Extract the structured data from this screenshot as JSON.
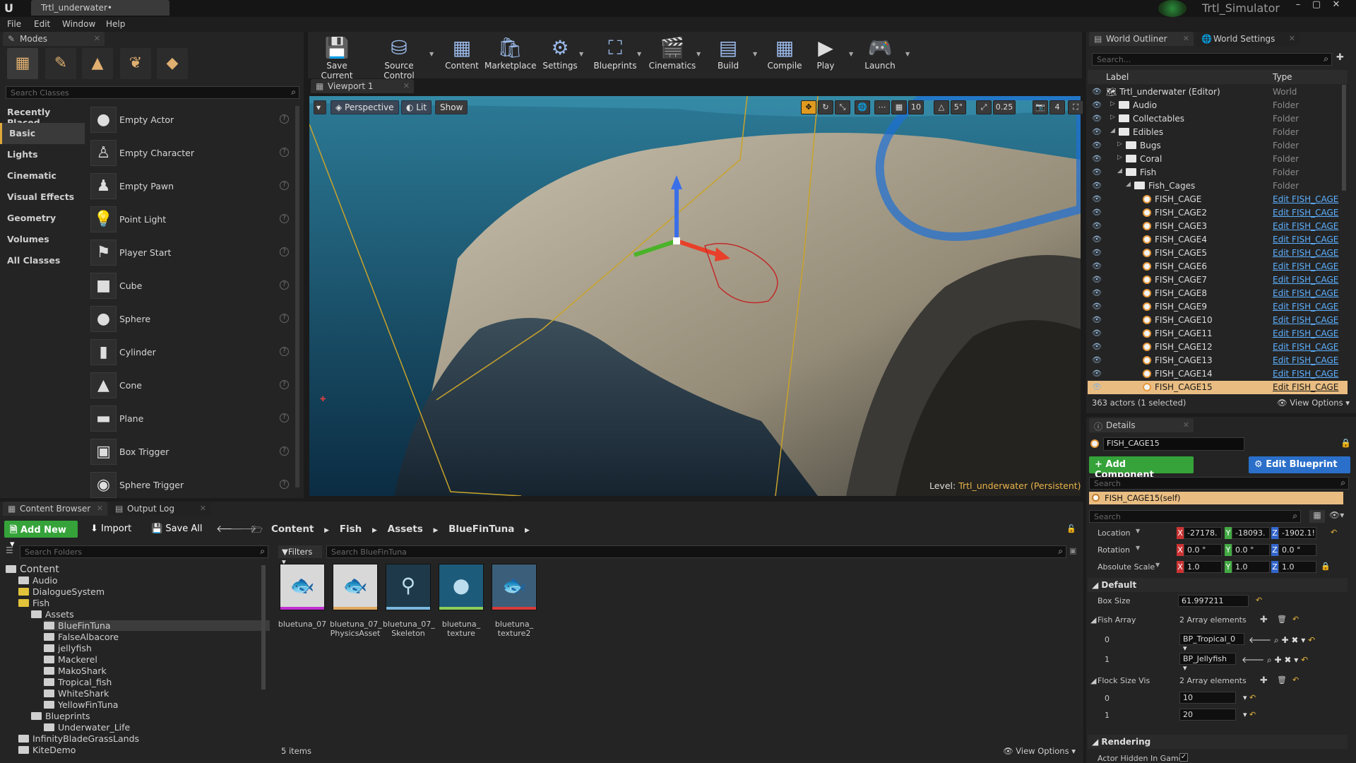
{
  "titlebar": {
    "doc_tab": "Trtl_underwater•",
    "app_title": "Trtl_Simulator",
    "min": "–",
    "max": "▢",
    "close": "✕"
  },
  "menu": [
    "File",
    "Edit",
    "Window",
    "Help"
  ],
  "modes": {
    "tab": "Modes",
    "search_placeholder": "Search Classes",
    "categories": [
      "Recently Placed",
      "Basic",
      "Lights",
      "Cinematic",
      "Visual Effects",
      "Geometry",
      "Volumes",
      "All Classes"
    ],
    "selected_category": "Basic",
    "items": [
      "Empty Actor",
      "Empty Character",
      "Empty Pawn",
      "Point Light",
      "Player Start",
      "Cube",
      "Sphere",
      "Cylinder",
      "Cone",
      "Plane",
      "Box Trigger",
      "Sphere Trigger"
    ],
    "help": "?"
  },
  "toolbar": [
    "Save Current",
    "Source Control",
    "Content",
    "Marketplace",
    "Settings",
    "Blueprints",
    "Cinematics",
    "Build",
    "Compile",
    "Play",
    "Launch"
  ],
  "viewport": {
    "tab": "Viewport 1",
    "perspective": "Perspective",
    "lit": "Lit",
    "show": "Show",
    "grid": "10",
    "angle": "5°",
    "scale": "0.25",
    "cam": "4",
    "level_label": "Level:",
    "level_name": "Trtl_underwater (Persistent)"
  },
  "outliner": {
    "tab": "World Outliner",
    "tab2": "World Settings",
    "search_placeholder": "Search...",
    "col_label": "Label",
    "col_type": "Type",
    "rows": [
      {
        "label": "Trtl_underwater (Editor)",
        "type": "World"
      },
      {
        "label": "Audio",
        "type": "Folder"
      },
      {
        "label": "Collectables",
        "type": "Folder"
      },
      {
        "label": "Edibles",
        "type": "Folder"
      },
      {
        "label": "Bugs",
        "type": "Folder"
      },
      {
        "label": "Coral",
        "type": "Folder"
      },
      {
        "label": "Fish",
        "type": "Folder"
      },
      {
        "label": "Fish_Cages",
        "type": "Folder"
      },
      {
        "label": "FISH_CAGE",
        "type": "Edit FISH_CAGE"
      },
      {
        "label": "FISH_CAGE2",
        "type": "Edit FISH_CAGE"
      },
      {
        "label": "FISH_CAGE3",
        "type": "Edit FISH_CAGE"
      },
      {
        "label": "FISH_CAGE4",
        "type": "Edit FISH_CAGE"
      },
      {
        "label": "FISH_CAGE5",
        "type": "Edit FISH_CAGE"
      },
      {
        "label": "FISH_CAGE6",
        "type": "Edit FISH_CAGE"
      },
      {
        "label": "FISH_CAGE7",
        "type": "Edit FISH_CAGE"
      },
      {
        "label": "FISH_CAGE8",
        "type": "Edit FISH_CAGE"
      },
      {
        "label": "FISH_CAGE9",
        "type": "Edit FISH_CAGE"
      },
      {
        "label": "FISH_CAGE10",
        "type": "Edit FISH_CAGE"
      },
      {
        "label": "FISH_CAGE11",
        "type": "Edit FISH_CAGE"
      },
      {
        "label": "FISH_CAGE12",
        "type": "Edit FISH_CAGE"
      },
      {
        "label": "FISH_CAGE13",
        "type": "Edit FISH_CAGE"
      },
      {
        "label": "FISH_CAGE14",
        "type": "Edit FISH_CAGE"
      },
      {
        "label": "FISH_CAGE15",
        "type": "Edit FISH_CAGE"
      }
    ],
    "status": "363 actors (1 selected)",
    "view_options": "View Options"
  },
  "details": {
    "tab": "Details",
    "name": "FISH_CAGE15",
    "add_component": "+ Add Component",
    "edit_blueprint": "Edit Blueprint",
    "search_placeholder": "Search",
    "self_row": "FISH_CAGE15(self)",
    "search2_placeholder": "Search",
    "location_label": "Location",
    "location": [
      "-27178.",
      "-18093.",
      "-1902.1!"
    ],
    "rotation_label": "Rotation",
    "rotation": [
      "0.0 °",
      "0.0 °",
      "0.0 °"
    ],
    "scale_label": "Absolute Scale",
    "scale": [
      "1.0",
      "1.0",
      "1.0"
    ],
    "section_default": "Default",
    "box_size_label": "Box Size",
    "box_size": "61.997211",
    "fish_array_label": "Fish Array",
    "fish_array_count": "2 Array elements",
    "fish0": "BP_Tropical_0",
    "fish1": "BP_Jellyfish",
    "flock_label": "Flock Size Vis",
    "flock_count": "2 Array elements",
    "flock0": "10",
    "flock1": "20",
    "idx0": "0",
    "idx1": "1",
    "section_rendering": "Rendering",
    "hidden_label": "Actor Hidden In Game"
  },
  "content_browser": {
    "tab": "Content Browser",
    "tab2": "Output Log",
    "add_new": "Add New",
    "import": "Import",
    "save_all": "Save All",
    "path": [
      "Content",
      "Fish",
      "Assets",
      "BlueFinTuna"
    ],
    "search_folders": "Search Folders",
    "filters": "Filters",
    "search_assets": "Search BlueFinTuna",
    "tree": [
      {
        "label": "Content",
        "depth": 0
      },
      {
        "label": "Audio",
        "depth": 1
      },
      {
        "label": "DialogueSystem",
        "depth": 1
      },
      {
        "label": "Fish",
        "depth": 1
      },
      {
        "label": "Assets",
        "depth": 2
      },
      {
        "label": "BlueFinTuna",
        "depth": 3
      },
      {
        "label": "FalseAlbacore",
        "depth": 3
      },
      {
        "label": "jellyfish",
        "depth": 3
      },
      {
        "label": "Mackerel",
        "depth": 3
      },
      {
        "label": "MakoShark",
        "depth": 3
      },
      {
        "label": "Tropical_fish",
        "depth": 3
      },
      {
        "label": "WhiteShark",
        "depth": 3
      },
      {
        "label": "YellowFinTuna",
        "depth": 3
      },
      {
        "label": "Blueprints",
        "depth": 2
      },
      {
        "label": "Underwater_Life",
        "depth": 3
      },
      {
        "label": "InfinityBladeGrassLands",
        "depth": 1
      },
      {
        "label": "KiteDemo",
        "depth": 1
      }
    ],
    "assets": [
      {
        "name": "bluetuna_07",
        "color": "#c02fd0"
      },
      {
        "name": "bluetuna_07_ PhysicsAsset",
        "color": "#e0a860"
      },
      {
        "name": "bluetuna_07_ Skeleton",
        "color": "#7ab7e0"
      },
      {
        "name": "bluetuna_ texture",
        "color": "#8ccf5a"
      },
      {
        "name": "bluetuna_ texture2",
        "color": "#d83b3b"
      }
    ],
    "items_count": "5 items",
    "view_options": "View Options"
  }
}
